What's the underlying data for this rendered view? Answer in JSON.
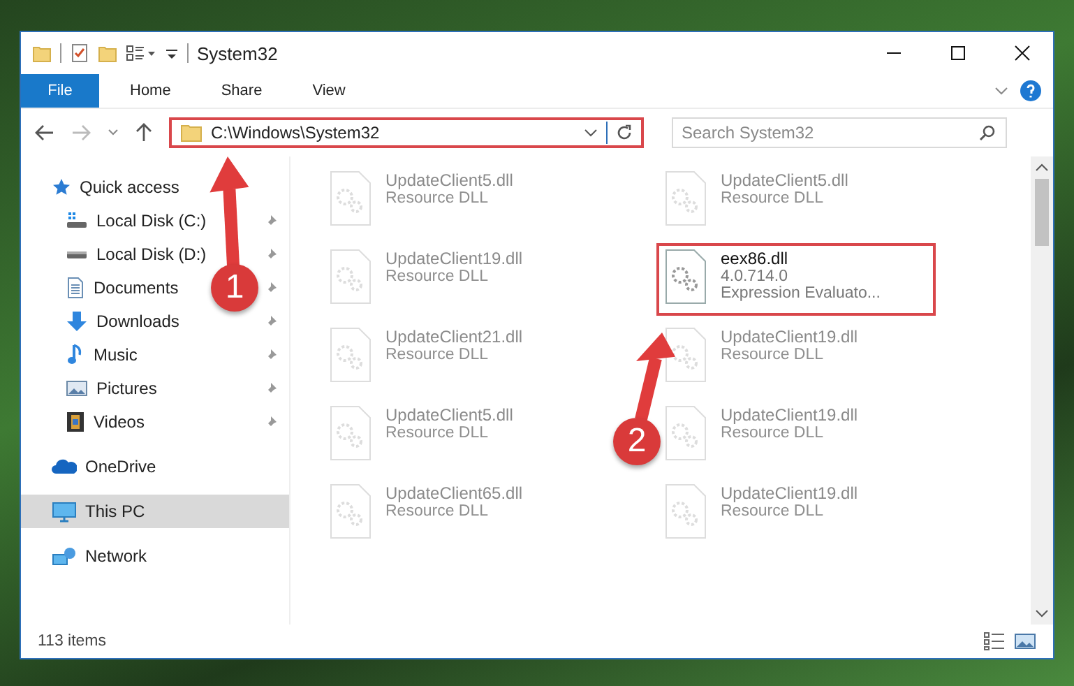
{
  "window": {
    "title": "System32"
  },
  "ribbon_tabs": [
    {
      "label": "File",
      "kind": "file",
      "selected": false
    },
    {
      "label": "Home",
      "kind": "tab",
      "selected": false
    },
    {
      "label": "Share",
      "kind": "tab",
      "selected": false
    },
    {
      "label": "View",
      "kind": "tab",
      "selected": false
    }
  ],
  "address": {
    "value": "C:\\Windows\\System32",
    "highlighted": true
  },
  "search": {
    "placeholder": "Search System32"
  },
  "sidebar": {
    "items": [
      {
        "label": "Quick access",
        "pinned": false,
        "selected": false
      },
      {
        "label": "Local Disk (C:)",
        "pinned": true,
        "selected": false
      },
      {
        "label": "Local Disk (D:)",
        "pinned": true,
        "selected": false
      },
      {
        "label": "Documents",
        "pinned": true,
        "selected": false
      },
      {
        "label": "Downloads",
        "pinned": true,
        "selected": false
      },
      {
        "label": "Music",
        "pinned": true,
        "selected": false
      },
      {
        "label": "Pictures",
        "pinned": true,
        "selected": false
      },
      {
        "label": "Videos",
        "pinned": true,
        "selected": false
      },
      {
        "label": "OneDrive",
        "pinned": false,
        "selected": false
      },
      {
        "label": "This PC",
        "pinned": false,
        "selected": true
      },
      {
        "label": "Network",
        "pinned": false,
        "selected": false
      }
    ]
  },
  "files": [
    {
      "name": "UpdateClient5.dll",
      "lines": [
        "Resource DLL"
      ],
      "dimmed": true,
      "highlighted": false
    },
    {
      "name": "UpdateClient5.dll",
      "lines": [
        "Resource DLL"
      ],
      "dimmed": true,
      "highlighted": false
    },
    {
      "name": "UpdateClient19.dll",
      "lines": [
        "Resource DLL"
      ],
      "dimmed": true,
      "highlighted": false
    },
    {
      "name": "eex86.dll",
      "lines": [
        "4.0.714.0",
        "Expression Evaluato..."
      ],
      "dimmed": false,
      "highlighted": true
    },
    {
      "name": "UpdateClient21.dll",
      "lines": [
        "Resource DLL"
      ],
      "dimmed": true,
      "highlighted": false
    },
    {
      "name": "UpdateClient19.dll",
      "lines": [
        "Resource DLL"
      ],
      "dimmed": true,
      "highlighted": false
    },
    {
      "name": "UpdateClient5.dll",
      "lines": [
        "Resource DLL"
      ],
      "dimmed": true,
      "highlighted": false
    },
    {
      "name": "UpdateClient19.dll",
      "lines": [
        "Resource DLL"
      ],
      "dimmed": true,
      "highlighted": false
    },
    {
      "name": "UpdateClient65.dll",
      "lines": [
        "Resource DLL"
      ],
      "dimmed": true,
      "highlighted": false
    },
    {
      "name": "UpdateClient19.dll",
      "lines": [
        "Resource DLL"
      ],
      "dimmed": true,
      "highlighted": false
    }
  ],
  "status_bar": {
    "count": "113 items"
  },
  "annotations": [
    {
      "number": "1"
    },
    {
      "number": "2"
    }
  ]
}
